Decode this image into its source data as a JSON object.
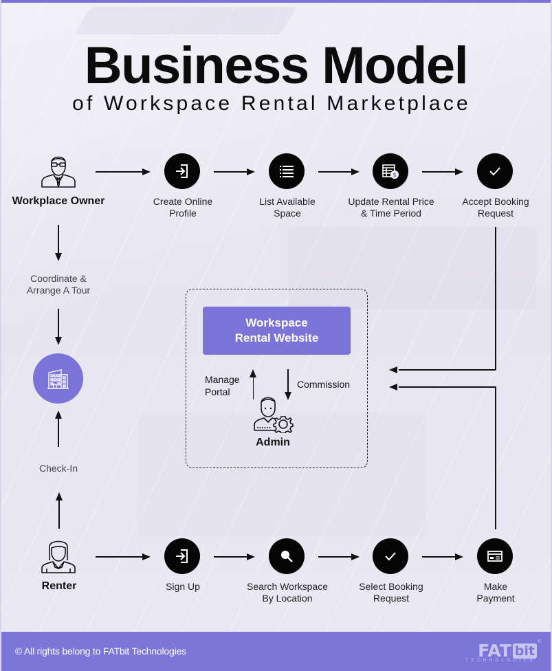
{
  "title": "Business Model",
  "subtitle": "of Workspace Rental Marketplace",
  "owner_flow": {
    "actor": "Workplace Owner",
    "steps": [
      {
        "label_line1": "Create Online",
        "label_line2": "Profile",
        "icon": "sign-in-icon"
      },
      {
        "label_line1": "List Available",
        "label_line2": "Space",
        "icon": "list-icon"
      },
      {
        "label_line1": "Update Rental Price",
        "label_line2": "& Time Period",
        "icon": "price-sheet-icon"
      },
      {
        "label_line1": "Accept Booking",
        "label_line2": "Request",
        "icon": "check-icon"
      }
    ]
  },
  "renter_flow": {
    "actor": "Renter",
    "steps": [
      {
        "label_line1": "Sign Up",
        "label_line2": "",
        "icon": "sign-in-icon"
      },
      {
        "label_line1": "Search Workspace",
        "label_line2": "By Location",
        "icon": "search-icon"
      },
      {
        "label_line1": "Select Booking",
        "label_line2": "Request",
        "icon": "check-icon"
      },
      {
        "label_line1": "Make",
        "label_line2": "Payment",
        "icon": "credit-card-icon"
      }
    ]
  },
  "left_column": {
    "tour_line1": "Coordinate &",
    "tour_line2": "Arrange A Tour",
    "workspace_icon": "building-icon",
    "checkin": "Check-In"
  },
  "center": {
    "website_line1": "Workspace",
    "website_line2": "Rental Website",
    "manage_line1": "Manage",
    "manage_line2": "Portal",
    "commission": "Commission",
    "admin": "Admin"
  },
  "footer": {
    "copyright": "© All rights belong to FATbit Technologies",
    "logo_main": "FAT",
    "logo_bit": "bit",
    "logo_sub": "TECHNOLOGIES",
    "logo_reg": "®"
  },
  "colors": {
    "accent": "#7b74d8",
    "node": "#050505",
    "background": "#ecebf4"
  }
}
